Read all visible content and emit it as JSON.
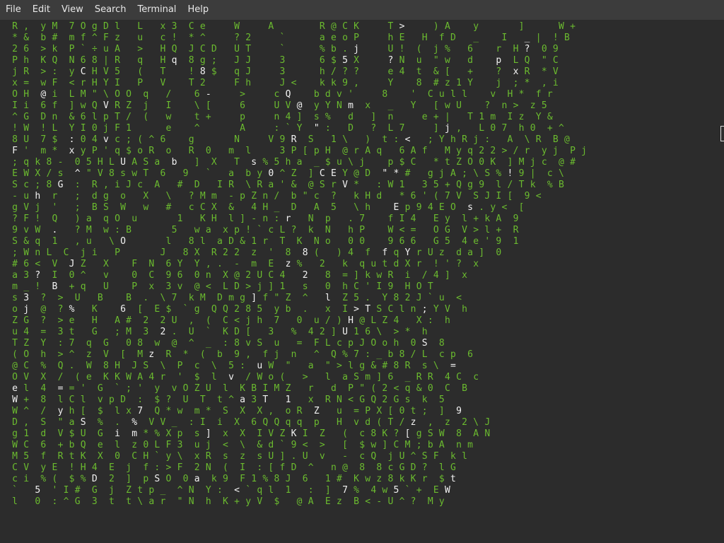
{
  "menu": [
    "File",
    "Edit",
    "View",
    "Search",
    "Terminal",
    "Help"
  ],
  "colors": {
    "rain": "#6bbb2f",
    "head": "#f2f2f2",
    "background": "#2c2c2c",
    "menubar": "#3c3c3c"
  },
  "rain": {
    "start_row": 1,
    "columns": [
      {
        "col": 0,
        "start": 19,
        "chars": "X;jMJ"
      },
      {
        "col": 1,
        "start": 15,
        "chars": "S-gF9S;#as1*[RwDfUs<DI"
      },
      {
        "col": 1,
        "start": 37,
        "chars": "D1W5Vcˋ"
      },
      {
        "col": 3,
        "start": 0,
        "chars": "R*2PjxOI!!8F;E"
      },
      {
        "col": 3,
        "start": 14,
        "chars": "cuVFvw&ndMJs1*[R-5Df"
      },
      {
        "col": 4,
        "start": 0,
        "chars": ",&6hRcH>Wv/"
      },
      {
        "col": 5,
        "start": 9,
        "chars": "6!Wtq8:hr"
      },
      {
        "col": 6,
        "start": 1,
        "chars": "bK:Y@6L*mB8S"
      },
      {
        "col": 8,
        "start": 0,
        "chars": "y>Q>wiN&UmP7%e%l0J"
      },
      {
        "col": 9,
        "start": 0,
        "chars": "M>Q>wiN"
      },
      {
        "col": 9,
        "start": 18,
        "chars": "J"
      }
    ]
  },
  "grid_text": [
    "  R ,  y M  7 O g D l   L   x 3  C e     W     A        R @ C K     T >     ) A    y       ]      W +",
    "  * &  b #  m f ^ F z   u   c !  * ^     ? 2     `      a e o P     h E   H  f D   _    I   _ |  ! B",
    "  2 6  > k  P ` ÷ u A   >   H Q  J C D   U T     `      % b . j     U !  (  j %   6    r  H ?  0 9",
    "  P h  K Q  N 6 8 | R   q   H q  8 g ;   J J     3      6 $ 5 X     ? N  u  \" w   d    p  L Q  \" C",
    "  j R  > :  y C H V 5   (   T    ! 8 $   q J     3      h / ? ?     e 4  t  & [   +    ?  x R  * V",
    "  x =  w F  < r H Y I   P   V    T 2     F h     J <    k k 9 ,     Y    8  # z 1 Y    j  ; *  , i",
    "  O H  @ i  L M \" \\ O O  q   /    6 -     >     c Q    b d v '     8    '  C u l l    v  H *  f r",
    "  I i  6 f  ] w Q V R Z  j   I    \\ [     6     U V @  y Y N m  x   _   Y   [ w U    ?  n >  z 5",
    "  ^ G  D n  & 6 l p T /  (   w    t +     p     n 4 ]  s %   d   ]  n     e + |   T 1 m  I z  Y &",
    "  ! W  ! L  Y I 0 j F 1      e    ^       A     : ` Y  \" :   D   ?  L 7     ] j ,   L 0 7  h 0  + ^",
    "  8 U  7 $  : 0 4 v c ; ( ^ 6    g       N     V 9 R  S   1 \\   )  t : <   ; Y h R j :   A  \\ R  B @",
    "  F '  m *  x y P ' q $ o R  o   R  0   m  l     3 P [ p H  @ r A q   6 A f   M y q 2 2 > / r  y j  P j",
    "  ; q k 8 -  0 5 H L U A S a  b   ]  X   T  s % 5 h a  _ $ u \\ j    p $ C   * t Z O 0 K  ] M j c  @ #",
    "  E W X / s  ^ \" V 8 s w T  6   9   `   a  b y 0 ^ Z  ] C E Y @ D  \" * #   g j A ; \\ S % ! 9 |  c \\",
    "  S c ; 8 G  :  R , i J c  A   #  D   I R  \\ R a ' &  @ S r V *   : W 1   3 5 + Q g 9  l / T k  % B",
    "  - u h  r   ;  d g  o   X   \\   ? M m  - p Z n /  b \" c  ?   k H d   * 6 ' ( 7 V  S J I [  9 <",
    "  g V j  '   ;  B S  W   w   #   c C X  &   4 H _  D   A  5   \\ h    E p 9 4 E O  s . y <  [",
    "  ? F !  Q   ) a  q O  u       1   K H  l ] - n : r   N  p   . 7    f I 4   E y  l + k A  9",
    "  9 v W  .   ? M  w : B       5   w a  x p ! ` c L ?  k  N   h P    W < =   O G  V > l +  R",
    "  S & q  1   , u   \\ O       l   8 l  a D & 1 r  T  K  N o   0 0    9 6 6   G 5  4 e ' 9  1",
    "  ; W n L  C  j i   P       J   8 X  R 2 2  z  '  8  8 (   ) 4  f  f q Y r U z  d a ]  0",
    "  # 6 <  V  J Z   X    F  N  6 Y  Y , .  -  m  E  z %   2   k  q u t d X r  ! ' ?  x",
    "  a 3 ?  I  0 ^   v    0  C  9 6  0 n  X @ 2 U C 4   2   8  = ] k w R  i  / 4 ]  x",
    "  m _ !  B  + q   U    P  x  3 v  @ <  L D > j ] 1   s   0  h C ' I 9  H O T",
    "  s 3  ?  >  U   B    B  .  \\ 7  k M  D m g ] f \" Z  ^   l  Z 5 .  Y 8 2 J ` u  <",
    "  o j  @  ? %   K    6  [  E $  ` g  Q Q 2 8 5  y b  .   x  I > T S C l n ; Y V  h",
    "  Z G  ?  > e   H   A #  2  2 U  ,  (  C < j h  7   0  u / ) H @ L Z 4   X :  h",
    "  u 4  =  3 t   G   ; M  3  2 .  U  `  K D [   3   %  4 2 ] U 1 6 \\  > *  h",
    "  T Z  Y  : 7  q  G   0 8  w  @  ^  _  : 8 v S  u   =  F L c p J O o h  0 S  8",
    "  ( O  h  > ^  z  V  [  M z  R  *  (  b  9 ,  f j  n   ^  Q % 7 : _ b 8 / L  c p  6",
    "  @ C  %  Q .  W  8 H  J S  \\  P  c  \\  5 :  u W  \"   a  \" > l g & # 8 R  s \\  =",
    "  O V  X  /  ( e  K K W A 4 r  '  $  l  v  / W o (   >   l  a S m ] 6  _ R R  4 C  c",
    "  e l  4  = = '  G  ` ; '  y  v O Z U  l  K B I M Z   r   d  P \" ( 2 < q & 0  C  B",
    "  W +  8  l C l  v p D  :  $ ?  U  T  t ^ a 3 T   1   x  R N < G Q 2 G s  k  5",
    "  W ^  /  y h [  $  l x 7  Q * w  m *  S  X  X ,  o R  Z   u  = P X [ 0 t ;  ]  9",
    "  D ,  S  \" a S  %  .  %  V V _  : I  i  X  6 Q Q q q  p   H  v d ( T / z  ,  z  2 \\ J",
    "  g 1  d  V $ U  G  i  m * % X p  s ]  x  X  I V Z K I  Z   (  c 8 K ? [ g S W  8  A N",
    "  W C  6  + b Q  e  l  z 0 L F 3  u j  <  \\  & d ` 9 <  >   [  $ w ] C M ; b A  n m",
    "  M 5  f  R t K  X  0  C H ` y \\  x R  s  z  s U ] . U  v   -  c Q  j U ^ S F  k l",
    "  C V  y E  ! H 4  E  j  f : > F  2 N  (  I  : [ f D  ^   n @  8  8 c G D ?  l G",
    "  c i  % (  $ % D  2  ]  p S O  0 a  k 9  F 1 % 8 J  6   1 #  K w z 8 k K r  $ t",
    "  `   5  ' I #  G  j  Z t p _  ^ N  Y :  < ` q l  1   :  ]  7 %  4 w 5 ` +  E W",
    "  l   0  : ^ G  3  t  t \\ a r  \" N  h  K + y V  $   @ A  E z  B < - U ^ ?  M y"
  ]
}
